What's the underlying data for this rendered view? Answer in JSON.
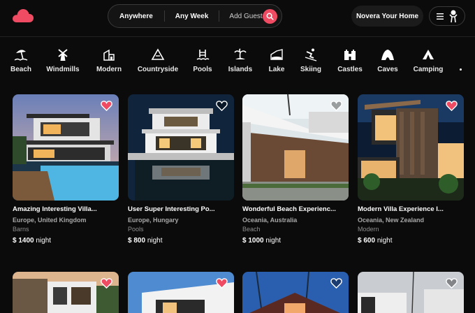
{
  "search": {
    "where": "Anywhere",
    "when": "Any Week",
    "guests": "Add Guest"
  },
  "header": {
    "host_label": "Novera Your Home"
  },
  "colors": {
    "brand": "#ef4b62",
    "background": "#0b0b0b"
  },
  "categories": [
    {
      "label": "Beach",
      "icon": "beach-icon"
    },
    {
      "label": "Windmills",
      "icon": "windmill-icon"
    },
    {
      "label": "Modern",
      "icon": "modern-house-icon"
    },
    {
      "label": "Countryside",
      "icon": "countryside-icon"
    },
    {
      "label": "Pools",
      "icon": "pool-icon"
    },
    {
      "label": "Islands",
      "icon": "island-icon"
    },
    {
      "label": "Lake",
      "icon": "lake-icon"
    },
    {
      "label": "Skiing",
      "icon": "skiing-icon"
    },
    {
      "label": "Castles",
      "icon": "castle-icon"
    },
    {
      "label": "Caves",
      "icon": "cave-icon"
    },
    {
      "label": "Camping",
      "icon": "camping-icon"
    }
  ],
  "listings": [
    {
      "title": "Amazing Interesting Villa...",
      "location": "Europe, United Kingdom",
      "type": "Barns",
      "price": "$ 1400",
      "unit": "night",
      "favorited": true
    },
    {
      "title": "User Super Interesting Po...",
      "location": "Europe, Hungary",
      "type": "Pools",
      "price": "$ 800",
      "unit": "night",
      "favorited": false
    },
    {
      "title": "Wonderful Beach Experienc...",
      "location": "Oceania, Australia",
      "type": "Beach",
      "price": "$ 1000",
      "unit": "night",
      "favorited": false
    },
    {
      "title": "Modern Villa Experience I...",
      "location": "Oceania, New Zealand",
      "type": "Modern",
      "price": "$ 600",
      "unit": "night",
      "favorited": true
    },
    {
      "favorited": true
    },
    {
      "favorited": true
    },
    {
      "favorited": false
    },
    {
      "favorited": false
    }
  ]
}
